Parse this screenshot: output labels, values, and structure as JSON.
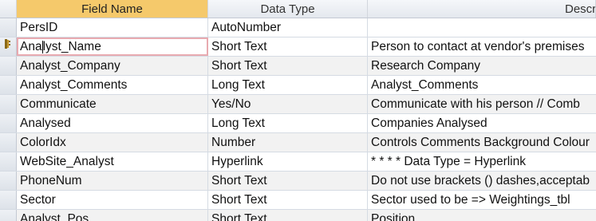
{
  "columns": {
    "field_name": "Field Name",
    "data_type": "Data Type",
    "description": "Descri"
  },
  "rows": [
    {
      "name": "PersID",
      "type": "AutoNumber",
      "desc": ""
    },
    {
      "name_before_caret": "Ana",
      "name_after_caret": "lyst_Name",
      "name": "Analyst_Name",
      "type": "Short Text",
      "desc": "Person to contact at vendor's premises"
    },
    {
      "name": "Analyst_Company",
      "type": "Short Text",
      "desc": "Research Company"
    },
    {
      "name": "Analyst_Comments",
      "type": "Long Text",
      "desc": "Analyst_Comments"
    },
    {
      "name": "Communicate",
      "type": "Yes/No",
      "desc": "Communicate with his person //  Comb"
    },
    {
      "name": "Analysed",
      "type": "Long Text",
      "desc": "Companies Analysed"
    },
    {
      "name": "ColorIdx",
      "type": "Number",
      "desc": "Controls Comments Background Colour"
    },
    {
      "name": "WebSite_Analyst",
      "type": "Hyperlink",
      "desc": "* * * * Data Type = Hyperlink"
    },
    {
      "name": "PhoneNum",
      "type": "Short Text",
      "desc": "Do not use brackets () dashes,acceptab"
    },
    {
      "name": "Sector",
      "type": "Short Text",
      "desc": "Sector used to be => Weightings_tbl"
    },
    {
      "name": "Analyst_Pos",
      "type": "Short Text",
      "desc": "Position"
    }
  ],
  "icons": {
    "row_selector_active": "row-selector-pencil-icon"
  }
}
